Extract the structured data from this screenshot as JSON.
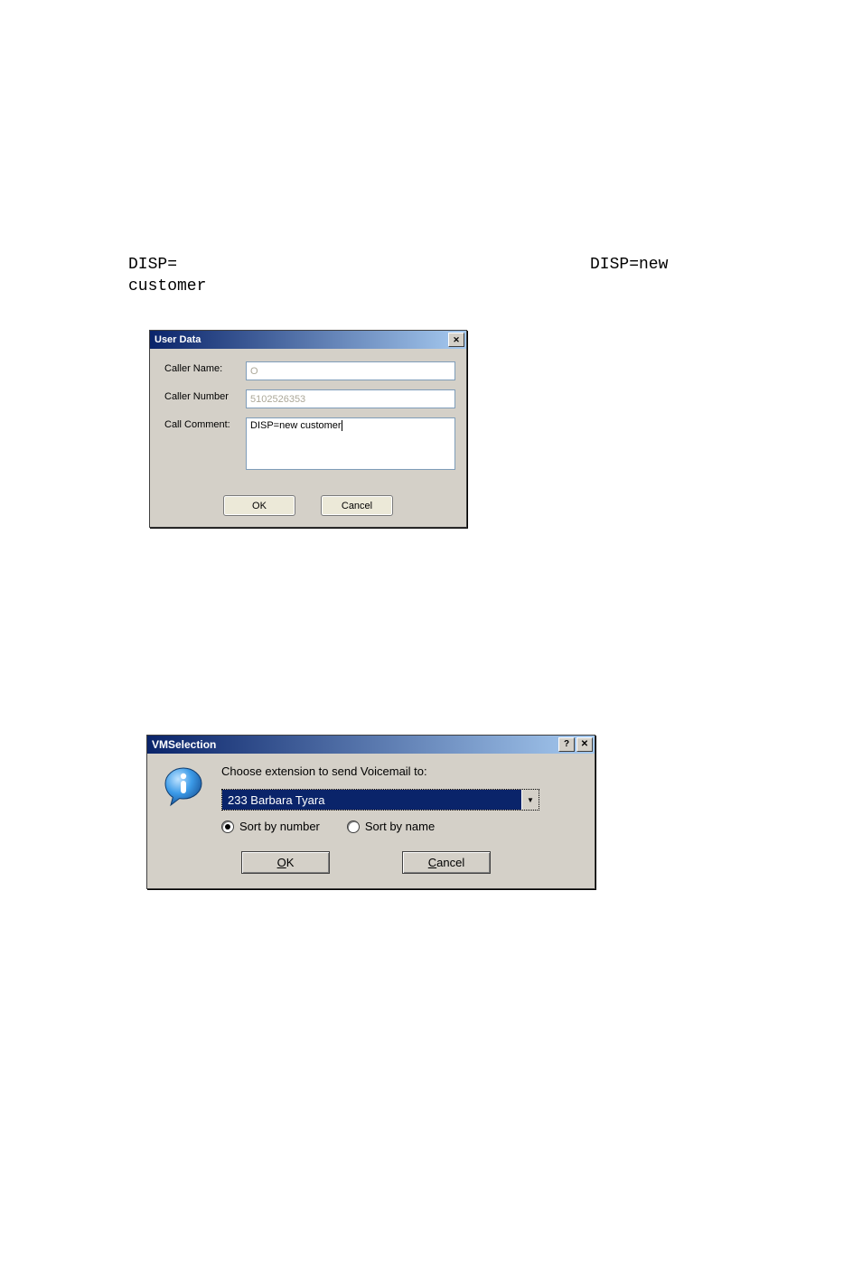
{
  "doc": {
    "code1": "DISP=",
    "code2": "DISP=new",
    "code3": "customer"
  },
  "userData": {
    "title": "User Data",
    "labels": {
      "callerName": "Caller Name:",
      "callerNumber": "Caller Number",
      "callComment": "Call Comment:"
    },
    "values": {
      "callerName": "O",
      "callerNumber": "5102526353",
      "callComment": "DISP=new customer"
    },
    "buttons": {
      "ok": "OK",
      "cancel": "Cancel"
    }
  },
  "vm": {
    "title": "VMSelection",
    "prompt": "Choose extension to send Voicemail to:",
    "selected": "233 Barbara Tyara",
    "radios": {
      "byNumber": "Sort by number",
      "byName": "Sort by name"
    },
    "buttons": {
      "ok_u": "O",
      "ok_rest": "K",
      "cancel_u": "C",
      "cancel_rest": "ancel"
    }
  }
}
